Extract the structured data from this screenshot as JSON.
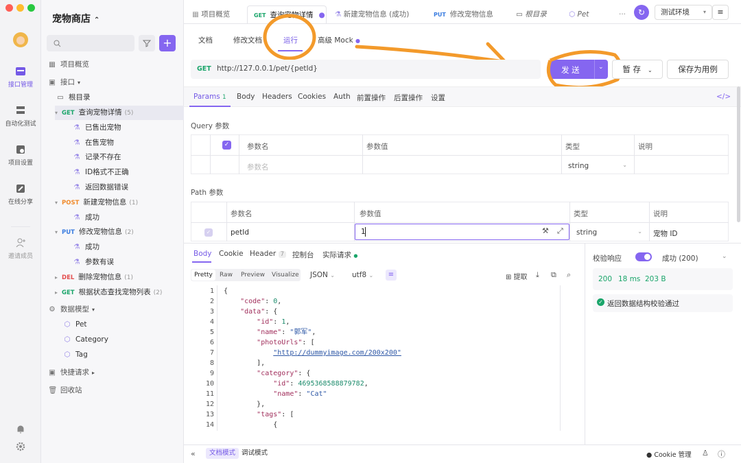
{
  "rail": {
    "items": [
      {
        "label": "接口管理"
      },
      {
        "label": "自动化测试"
      },
      {
        "label": "项目设置"
      },
      {
        "label": "在线分享"
      },
      {
        "label": "邀请成员"
      }
    ]
  },
  "sidebar": {
    "project_title": "宠物商店",
    "overview": "项目概览",
    "api_section": "接口",
    "root": "根目录",
    "tree": [
      {
        "method": "GET",
        "name": "查询宠物详情",
        "count": "(5)",
        "mclass": "get"
      },
      {
        "name": "已售出宠物"
      },
      {
        "name": "在售宠物"
      },
      {
        "name": "记录不存在"
      },
      {
        "name": "ID格式不正确"
      },
      {
        "name": "返回数据错误"
      },
      {
        "method": "POST",
        "name": "新建宠物信息",
        "count": "(1)",
        "mclass": "post"
      },
      {
        "name": "成功"
      },
      {
        "method": "PUT",
        "name": "修改宠物信息",
        "count": "(2)",
        "mclass": "put"
      },
      {
        "name": "成功"
      },
      {
        "name": "参数有误"
      },
      {
        "method": "DEL",
        "name": "删除宠物信息",
        "count": "(1)",
        "mclass": "del"
      },
      {
        "method": "GET",
        "name": "根据状态查找宠物列表",
        "count": "(2)",
        "mclass": "get"
      }
    ],
    "models_section": "数据模型",
    "models": [
      "Pet",
      "Category",
      "Tag"
    ],
    "quick": "快捷请求",
    "trash": "回收站"
  },
  "tabs": [
    {
      "label": "项目概览"
    },
    {
      "method": "GET",
      "label": "查询宠物详情"
    },
    {
      "label": "新建宠物信息 (成功)"
    },
    {
      "method": "PUT",
      "label": "修改宠物信息"
    },
    {
      "label": "根目录"
    },
    {
      "label": "Pet"
    }
  ],
  "env": "测试环境",
  "subnav": [
    "文档",
    "修改文档",
    "运行",
    "高级 Mock"
  ],
  "request": {
    "method": "GET",
    "url": "http://127.0.0.1/pet/{petId}",
    "send": "发 送",
    "save": "暂 存",
    "save_case": "保存为用例"
  },
  "param_tabs": [
    "Params",
    "Body",
    "Headers",
    "Cookies",
    "Auth",
    "前置操作",
    "后置操作",
    "设置"
  ],
  "params_count": "1",
  "query": {
    "title": "Query 参数",
    "headers": [
      "参数名",
      "参数值",
      "类型",
      "说明"
    ],
    "placeholder": "参数名",
    "type": "string"
  },
  "path": {
    "title": "Path 参数",
    "headers": [
      "参数名",
      "参数值",
      "类型",
      "说明"
    ],
    "row": {
      "name": "petId",
      "value": "1",
      "type": "string",
      "desc": "宠物 ID"
    }
  },
  "response_tabs": [
    "Body",
    "Cookie",
    "Header",
    "控制台",
    "实际请求"
  ],
  "header_count": "7",
  "format_tabs": [
    "Pretty",
    "Raw",
    "Preview",
    "Visualize"
  ],
  "format": "JSON",
  "encoding": "utf8",
  "extract": "提取",
  "code_lines": [
    "{",
    "    \"code\": 0,",
    "    \"data\": {",
    "        \"id\": 1,",
    "        \"name\": \"郭军\",",
    "        \"photoUrls\": [",
    "            \"http://dummyimage.com/200x200\"",
    "        ],",
    "        \"category\": {",
    "            \"id\": 4695368588879782,",
    "            \"name\": \"Cat\"",
    "        },",
    "        \"tags\": [",
    "            {"
  ],
  "validation": {
    "label": "校验响应",
    "result": "成功 (200)",
    "status": "200",
    "time": "18 ms",
    "size": "203 B",
    "message": "返回数据结构校验通过"
  },
  "footer": {
    "doc_mode": "文档模式",
    "debug_mode": "调试模式",
    "cookie": "Cookie 管理"
  },
  "colors": {
    "accent": "#8566f0",
    "annotation": "#f39a2b"
  }
}
